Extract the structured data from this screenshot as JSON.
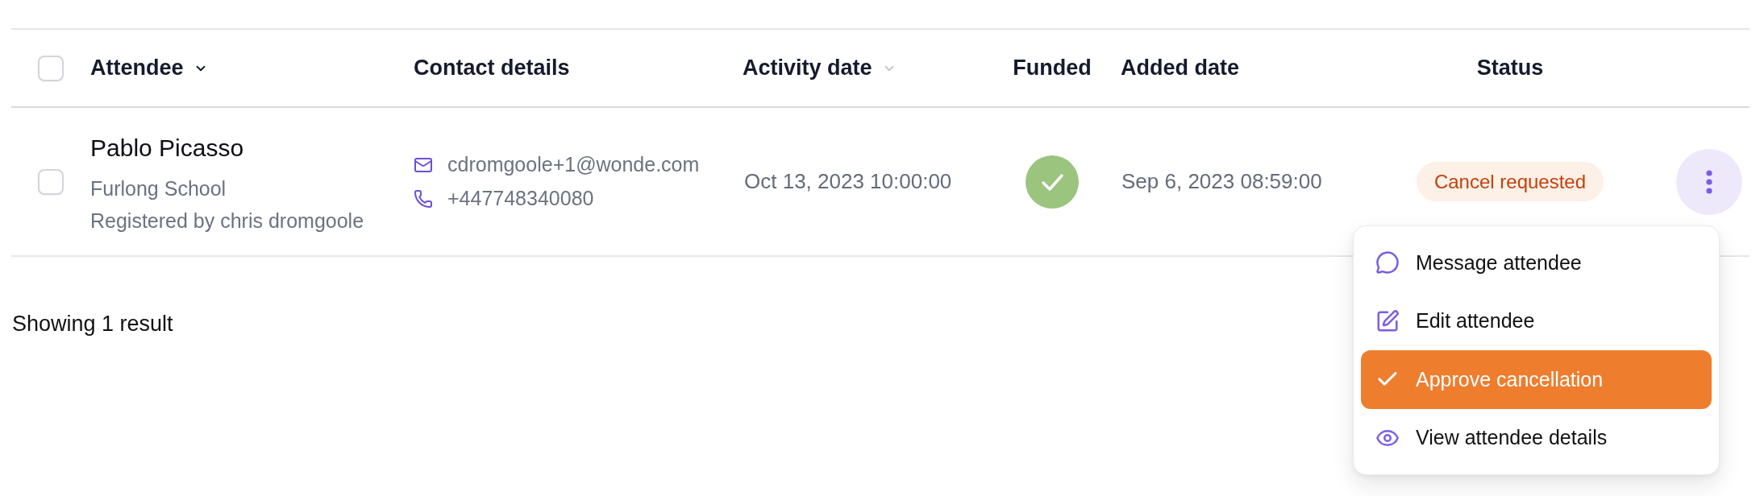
{
  "table": {
    "select_all": {
      "checked": false
    },
    "columns": [
      {
        "label": "Attendee",
        "sortable": true,
        "sorted": true
      },
      {
        "label": "Contact details",
        "sortable": false,
        "sorted": false
      },
      {
        "label": "Activity date",
        "sortable": true,
        "sorted": false
      },
      {
        "label": "Funded",
        "sortable": false,
        "sorted": false
      },
      {
        "label": "Added date",
        "sortable": false,
        "sorted": false
      },
      {
        "label": "Status",
        "sortable": false,
        "sorted": false
      }
    ],
    "rows": [
      {
        "checked": false,
        "name": "Pablo Picasso",
        "school": "Furlong School",
        "registered_by": "Registered by chris dromgoole",
        "email": "cdromgoole+1@wonde.com",
        "phone": "+447748340080",
        "activity_date": "Oct 13, 2023 10:00:00",
        "funded": true,
        "added_date": "Sep 6, 2023 08:59:00",
        "status": "Cancel requested",
        "menu": {
          "open": true,
          "items": [
            {
              "kind": "message",
              "label": "Message attendee",
              "selected": false
            },
            {
              "kind": "edit",
              "label": "Edit attendee",
              "selected": false
            },
            {
              "kind": "approve",
              "label": "Approve cancellation",
              "selected": true
            },
            {
              "kind": "view",
              "label": "View attendee details",
              "selected": false
            }
          ]
        }
      }
    ]
  },
  "footer": {
    "result_count": "Showing 1 result"
  }
}
